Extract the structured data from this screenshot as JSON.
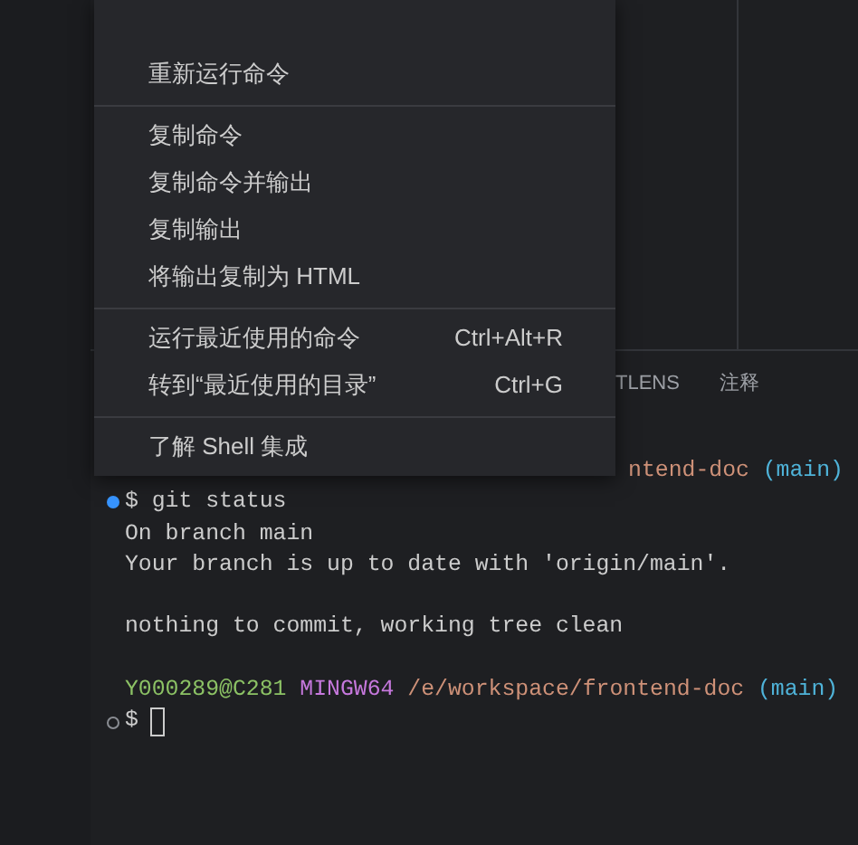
{
  "menu": {
    "groups": [
      {
        "items": [
          {
            "label": "重新运行命令"
          }
        ]
      },
      {
        "items": [
          {
            "label": "复制命令"
          },
          {
            "label": "复制命令并输出"
          },
          {
            "label": "复制输出"
          },
          {
            "label": "将输出复制为 HTML"
          }
        ]
      },
      {
        "items": [
          {
            "label": "运行最近使用的命令",
            "shortcut": "Ctrl+Alt+R"
          },
          {
            "label": "转到“最近使用的目录”",
            "shortcut": "Ctrl+G"
          }
        ]
      },
      {
        "items": [
          {
            "label": "了解 Shell 集成"
          }
        ]
      }
    ]
  },
  "panel_tabs": [
    {
      "label": "TLENS"
    },
    {
      "label": "注释"
    }
  ],
  "terminal": {
    "covered_prompt": {
      "path": "ntend-doc",
      "branch": "(main)"
    },
    "commands": [
      {
        "done": true,
        "prompt": "$",
        "command": "git status",
        "output": [
          [
            "On branch main",
            "Your branch is up to date with 'origin/main'."
          ],
          [
            "nothing to commit, working tree clean"
          ]
        ]
      }
    ],
    "prompt": {
      "user": "Y000289@C281",
      "system": "MINGW64",
      "path": "/e/workspace/frontend-doc",
      "branch": "(main)"
    },
    "current": {
      "done": false,
      "prompt": "$"
    }
  }
}
